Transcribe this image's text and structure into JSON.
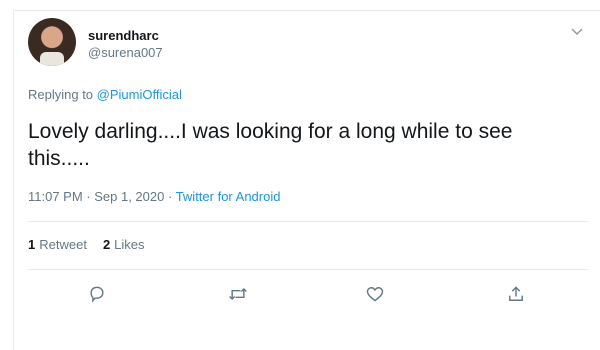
{
  "tweet": {
    "display_name": "surendharc",
    "handle": "@surena007",
    "replying_prefix": "Replying to",
    "replying_to": "@PiumiOfficial",
    "text": "Lovely darling....I was looking for a long while to see this.....",
    "timestamp": "11:07 PM · Sep 1, 2020 ·",
    "source": "Twitter for Android"
  },
  "stats": {
    "retweets_count": "1",
    "retweets_label": "Retweet",
    "likes_count": "2",
    "likes_label": "Likes"
  },
  "icons": {
    "menu": "chevron-down-icon",
    "reply": "reply-icon",
    "retweet": "retweet-icon",
    "like": "heart-icon",
    "share": "share-icon"
  },
  "colors": {
    "link": "#1b95e0",
    "muted": "#657786",
    "text": "#14171a",
    "divider": "#e6ecf0"
  }
}
